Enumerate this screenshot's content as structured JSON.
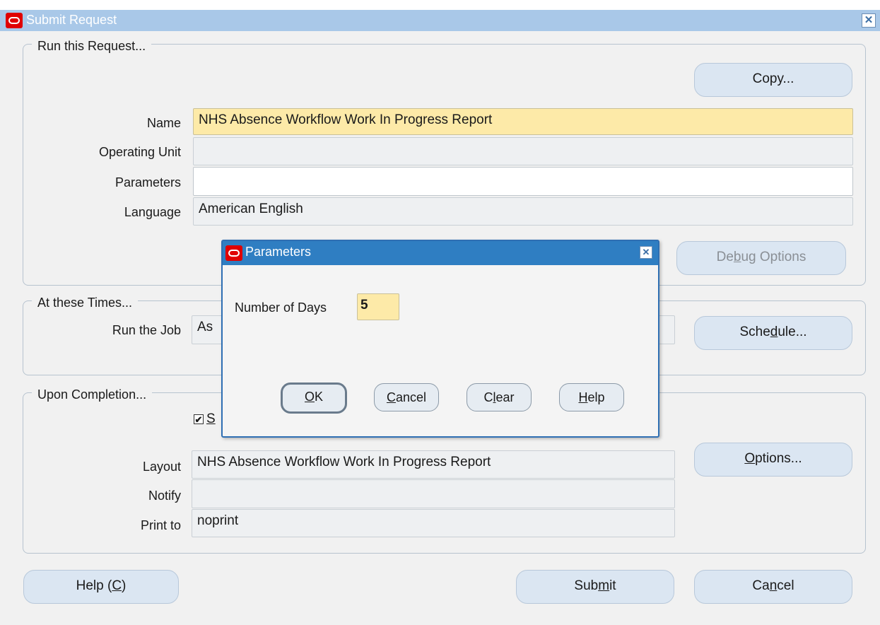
{
  "window": {
    "title": "Submit Request",
    "close_glyph": "✕"
  },
  "run_request": {
    "legend": "Run this Request...",
    "copy_button": {
      "before": "Copy",
      "after": "..."
    },
    "name_label": "Name",
    "name_value": "NHS Absence Workflow Work In Progress Report",
    "operating_unit_label": "Operating Unit",
    "operating_unit_value": "",
    "parameters_label": "Parameters",
    "parameters_value": "",
    "language_label": "Language",
    "language_value": "American English",
    "debug_button": {
      "before": "De",
      "mnemonic": "b",
      "after": "ug Options"
    }
  },
  "times": {
    "legend": "At these Times...",
    "run_job_label": "Run the Job",
    "run_job_value": "As",
    "schedule_button": {
      "before": "Sche",
      "mnemonic": "d",
      "after": "ule..."
    }
  },
  "completion": {
    "legend": "Upon Completion...",
    "save_checkbox_partial": "S",
    "save_checked": true,
    "layout_label": "Layout",
    "layout_value": "NHS Absence Workflow Work In Progress Report",
    "notify_label": "Notify",
    "notify_value": "",
    "print_to_label": "Print to",
    "print_to_value": "noprint",
    "options_button": {
      "mnemonic": "O",
      "after": "ptions..."
    }
  },
  "footer": {
    "help_button": {
      "before": "Help (",
      "mnemonic": "C",
      "after": ")"
    },
    "submit_button": {
      "before": "Sub",
      "mnemonic": "m",
      "after": "it"
    },
    "cancel_button": {
      "before": "Ca",
      "mnemonic": "n",
      "after": "cel"
    }
  },
  "dialog": {
    "title": "Parameters",
    "close_glyph": "✕",
    "days_label": "Number of Days",
    "days_value": "5",
    "ok_button": {
      "mnemonic": "O",
      "after": "K"
    },
    "cancel_button": {
      "mnemonic": "C",
      "after": "ancel"
    },
    "clear_button": {
      "before": "C",
      "mnemonic": "l",
      "after": "ear"
    },
    "help_button": {
      "mnemonic": "H",
      "after": "elp"
    }
  },
  "colors": {
    "titlebar": "#a9c8e8",
    "dialog_titlebar": "#2f7ec2",
    "required_field": "#fdeaa8",
    "button": "#dbe6f2",
    "oracle_red": "#e00000"
  },
  "icons": {
    "app_logo": "oracle-logo-icon",
    "close": "close-icon",
    "checkbox": "checkbox-icon"
  }
}
